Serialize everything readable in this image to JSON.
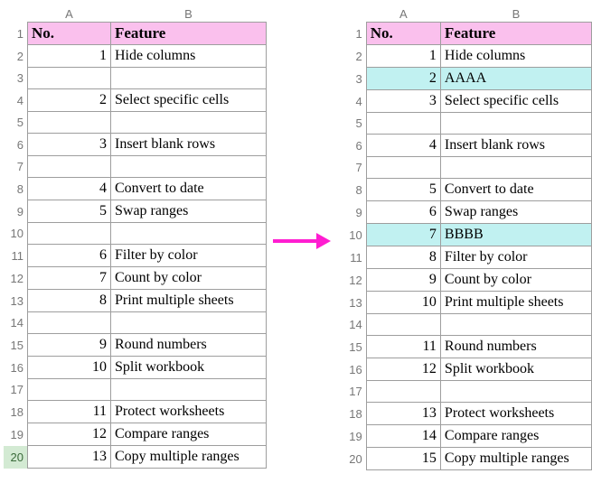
{
  "columns": [
    "A",
    "B"
  ],
  "header": {
    "no": "No.",
    "feature": "Feature"
  },
  "left": {
    "selected_row_label": "20",
    "rows": [
      {
        "rn": "1",
        "a": "No.",
        "b": "Feature",
        "title": true
      },
      {
        "rn": "2",
        "a": "1",
        "b": "Hide columns"
      },
      {
        "rn": "3",
        "a": "",
        "b": ""
      },
      {
        "rn": "4",
        "a": "2",
        "b": "Select specific cells"
      },
      {
        "rn": "5",
        "a": "",
        "b": ""
      },
      {
        "rn": "6",
        "a": "3",
        "b": "Insert blank rows"
      },
      {
        "rn": "7",
        "a": "",
        "b": ""
      },
      {
        "rn": "8",
        "a": "4",
        "b": "Convert to date"
      },
      {
        "rn": "9",
        "a": "5",
        "b": "Swap ranges"
      },
      {
        "rn": "10",
        "a": "",
        "b": ""
      },
      {
        "rn": "11",
        "a": "6",
        "b": "Filter by color"
      },
      {
        "rn": "12",
        "a": "7",
        "b": "Count by color"
      },
      {
        "rn": "13",
        "a": "8",
        "b": "Print multiple sheets"
      },
      {
        "rn": "14",
        "a": "",
        "b": ""
      },
      {
        "rn": "15",
        "a": "9",
        "b": "Round numbers"
      },
      {
        "rn": "16",
        "a": "10",
        "b": "Split workbook"
      },
      {
        "rn": "17",
        "a": "",
        "b": ""
      },
      {
        "rn": "18",
        "a": "11",
        "b": "Protect worksheets"
      },
      {
        "rn": "19",
        "a": "12",
        "b": "Compare ranges"
      },
      {
        "rn": "20",
        "a": "13",
        "b": "Copy multiple ranges",
        "sel": true
      }
    ]
  },
  "right": {
    "rows": [
      {
        "rn": "1",
        "a": "No.",
        "b": "Feature",
        "title": true
      },
      {
        "rn": "2",
        "a": "1",
        "b": "Hide columns"
      },
      {
        "rn": "3",
        "a": "2",
        "b": "AAAA",
        "hl": true
      },
      {
        "rn": "4",
        "a": "3",
        "b": "Select specific cells"
      },
      {
        "rn": "5",
        "a": "",
        "b": ""
      },
      {
        "rn": "6",
        "a": "4",
        "b": "Insert blank rows"
      },
      {
        "rn": "7",
        "a": "",
        "b": ""
      },
      {
        "rn": "8",
        "a": "5",
        "b": "Convert to date"
      },
      {
        "rn": "9",
        "a": "6",
        "b": "Swap ranges"
      },
      {
        "rn": "10",
        "a": "7",
        "b": "BBBB",
        "hl": true
      },
      {
        "rn": "11",
        "a": "8",
        "b": "Filter by color"
      },
      {
        "rn": "12",
        "a": "9",
        "b": "Count by color"
      },
      {
        "rn": "13",
        "a": "10",
        "b": "Print multiple sheets"
      },
      {
        "rn": "14",
        "a": "",
        "b": ""
      },
      {
        "rn": "15",
        "a": "11",
        "b": "Round numbers"
      },
      {
        "rn": "16",
        "a": "12",
        "b": "Split workbook"
      },
      {
        "rn": "17",
        "a": "",
        "b": ""
      },
      {
        "rn": "18",
        "a": "13",
        "b": "Protect worksheets"
      },
      {
        "rn": "19",
        "a": "14",
        "b": "Compare ranges"
      },
      {
        "rn": "20",
        "a": "15",
        "b": "Copy multiple ranges"
      }
    ]
  }
}
